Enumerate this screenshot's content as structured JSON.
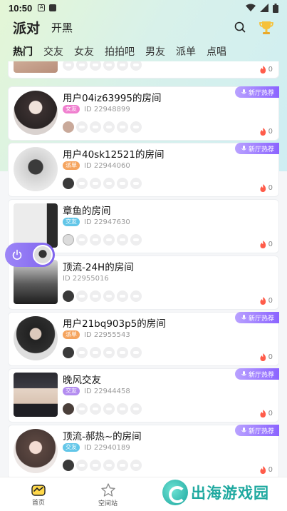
{
  "status": {
    "time": "10:50"
  },
  "header": {
    "tabs": [
      "派对",
      "开黑"
    ]
  },
  "categories": [
    "热门",
    "交友",
    "女友",
    "拍拍吧",
    "男友",
    "派单",
    "点唱"
  ],
  "top_partial": {
    "hot": "0"
  },
  "rooms": [
    {
      "title": "用户04iz63995的房间",
      "tag": "女友",
      "tag_color": "#f07fcf",
      "id": "ID 22948899",
      "hot": "0",
      "badge": "新厅热荐"
    },
    {
      "title": "用户40sk12521的房间",
      "tag": "派单",
      "tag_color": "#f5a45e",
      "id": "ID 22944060",
      "hot": "0",
      "badge": "新厅热荐"
    },
    {
      "title": "章鱼的房间",
      "tag": "交友",
      "tag_color": "#62c6e8",
      "id": "ID 22947630",
      "hot": "0",
      "badge": ""
    },
    {
      "title": "顶流-24H的房间",
      "tag": "",
      "tag_color": "#b38cf0",
      "id": "ID 22955016",
      "hot": "0",
      "badge": ""
    },
    {
      "title": "用户21bq903p5的房间",
      "tag": "派单",
      "tag_color": "#f5a45e",
      "id": "ID 22955543",
      "hot": "0",
      "badge": "新厅热荐"
    },
    {
      "title": "晚风交友",
      "tag": "交友",
      "tag_color": "#b38cf0",
      "id": "ID 22944458",
      "hot": "0",
      "badge": "新厅热荐"
    },
    {
      "title": "顶流-郝热~的房间",
      "tag": "交友",
      "tag_color": "#62c6e8",
      "id": "ID 22940189",
      "hot": "0",
      "badge": "新厅热荐"
    }
  ],
  "bottom_nav": [
    {
      "label": "首页"
    },
    {
      "label": "空间站"
    }
  ],
  "watermark": "出海游戏园"
}
